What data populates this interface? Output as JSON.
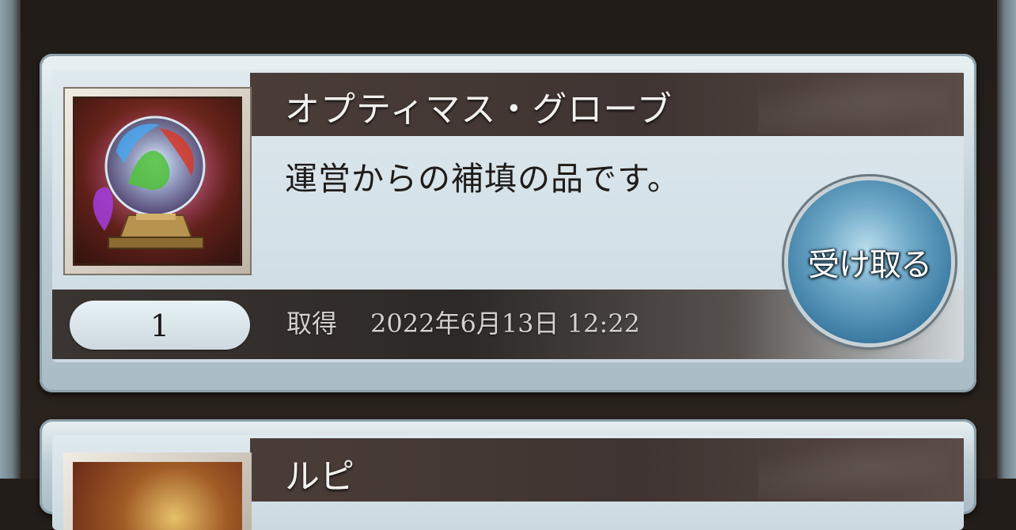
{
  "items": [
    {
      "name": "オプティマス・グローブ",
      "description": "運営からの補填の品です。",
      "quantity": "1",
      "acquired_label": "取得",
      "acquired_date": "2022年6月13日 12:22",
      "receive_label": "受け取る",
      "icon": "crystal-orb-icon"
    },
    {
      "name": "ルピ",
      "icon": "lupi-icon"
    }
  ],
  "colors": {
    "title_band": "#3f3431",
    "card_bg": "#d3e0e7",
    "button_blue": "#3f7ea5"
  }
}
